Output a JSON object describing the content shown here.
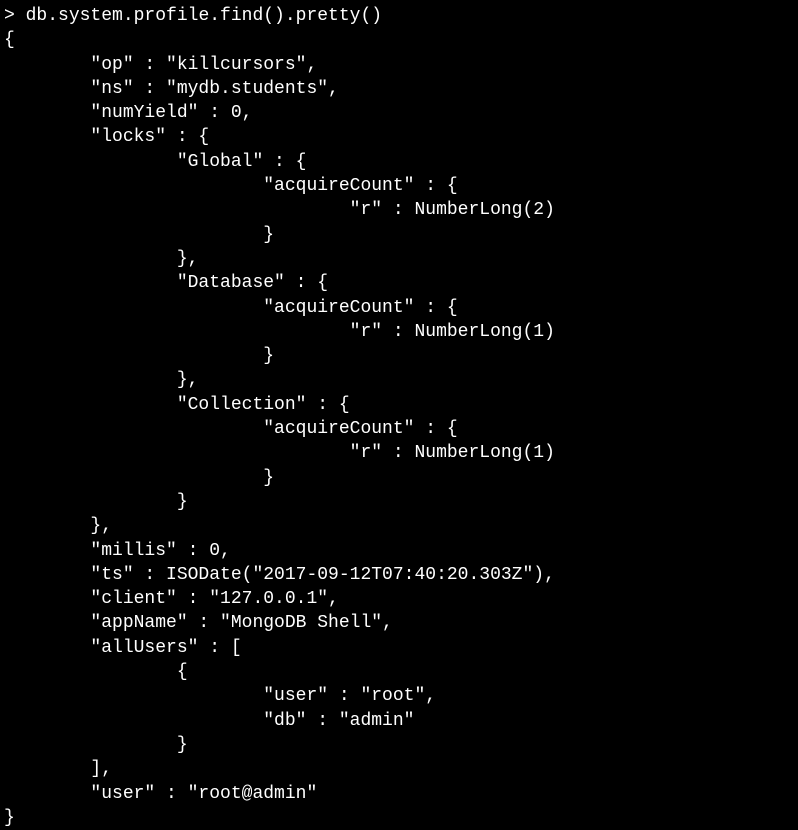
{
  "terminal": {
    "prompt": "> ",
    "command": "db.system.profile.find().pretty()",
    "lines": {
      "l01": "{",
      "l02": "        \"op\" : \"killcursors\",",
      "l03": "        \"ns\" : \"mydb.students\",",
      "l04": "        \"numYield\" : 0,",
      "l05": "        \"locks\" : {",
      "l06": "                \"Global\" : {",
      "l07": "                        \"acquireCount\" : {",
      "l08": "                                \"r\" : NumberLong(2)",
      "l09": "                        }",
      "l10": "                },",
      "l11": "                \"Database\" : {",
      "l12": "                        \"acquireCount\" : {",
      "l13": "                                \"r\" : NumberLong(1)",
      "l14": "                        }",
      "l15": "                },",
      "l16": "                \"Collection\" : {",
      "l17": "                        \"acquireCount\" : {",
      "l18": "                                \"r\" : NumberLong(1)",
      "l19": "                        }",
      "l20": "                }",
      "l21": "        },",
      "l22": "        \"millis\" : 0,",
      "l23": "        \"ts\" : ISODate(\"2017-09-12T07:40:20.303Z\"),",
      "l24": "        \"client\" : \"127.0.0.1\",",
      "l25": "        \"appName\" : \"MongoDB Shell\",",
      "l26": "        \"allUsers\" : [",
      "l27": "                {",
      "l28": "                        \"user\" : \"root\",",
      "l29": "                        \"db\" : \"admin\"",
      "l30": "                }",
      "l31": "        ],",
      "l32": "        \"user\" : \"root@admin\"",
      "l33": "}"
    }
  }
}
